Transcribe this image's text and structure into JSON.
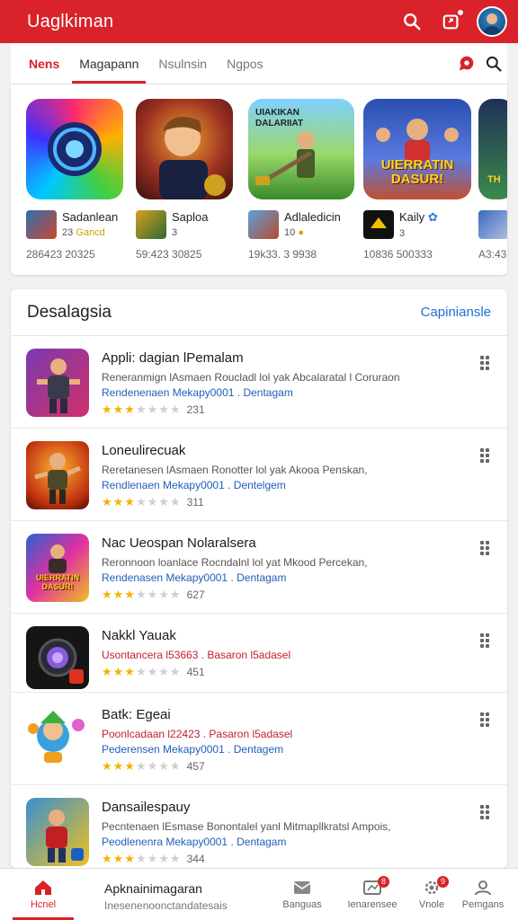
{
  "appbar": {
    "title": "Uaglkiman"
  },
  "tabs": [
    {
      "label": "Nens"
    },
    {
      "label": "Magapann"
    },
    {
      "label": "Nsulnsin"
    },
    {
      "label": "Ngpos"
    }
  ],
  "featured": [
    {
      "name": "Sadanlean",
      "sub_num": "23",
      "sub_tag": "Gancd",
      "stat": "286423 20325"
    },
    {
      "name": "Saploa",
      "sub_num": "3",
      "sub_tag": "",
      "stat": "59:423 30825"
    },
    {
      "name": "Adlaledicin",
      "sub_num": "10",
      "sub_tag": "",
      "stat": "19k33. 3 9938",
      "art_text": "UIAKIKAN DALARIIAT"
    },
    {
      "name": "Kaily",
      "sub_num": "3",
      "sub_tag": "",
      "stat": "10836 500333",
      "art_text": "UIERRATIN DASUR!"
    },
    {
      "name": "",
      "sub_num": "",
      "sub_tag": "",
      "stat": "A3:43",
      "art_text": "TH"
    }
  ],
  "section": {
    "title": "Desalagsia",
    "link": "Capinianslе"
  },
  "apps": [
    {
      "name": "Appli: dagian lPemalam",
      "desc": "Reneranmign lAsmaen Roucladl lol yak Abcalaratal l Coruraon",
      "dev": "Rendenenaen Mekapy0001 . Dentagam",
      "rating": "231",
      "stars": 3
    },
    {
      "name": "Loneulirecuak",
      "desc": "Reretanesen lAsmaen Ronotter lol yak Akooa Penskan,",
      "dev": "Rendlenaen Mekapy0001 . Dentelgem",
      "rating": "311",
      "stars": 3
    },
    {
      "name": "Nac Ueospan Nolaralsera",
      "desc": "Reronnoon loanlace Rocndalnl lol yat Mkood Percekan,",
      "dev": "Rendenasen Mekapy0001 . Dentagam",
      "rating": "627",
      "stars": 3,
      "art_text": "UIERRATIN DASUR!"
    },
    {
      "name": "Nakkl Yauak",
      "desc": "Usontancera l53663 . Basaron l5adasel",
      "dev": "",
      "rating": "451",
      "stars": 3,
      "desc_red": true
    },
    {
      "name": "Batk: Egeai",
      "desc": "Poonlcadaan l22423 . Pasaron l5adasel",
      "dev": "Pederensen Mekapy0001 . Dentagem",
      "rating": "457",
      "stars": 3,
      "desc_red": true
    },
    {
      "name": "Dansailespauy",
      "desc": "Pecntenaen lEsmase Bonontalel yanl Mitmapllkratsl Ampois,",
      "dev": "Peodlenenra Mekapy0001 . Dentagam",
      "rating": "344",
      "stars": 3
    }
  ],
  "bottom_nav": {
    "home": "Hcnel",
    "center_title": "Apknainimagaran",
    "center_sub": "Inesenenoonctandatesais",
    "items": [
      {
        "label": "Banguas"
      },
      {
        "label": "Ienarensee",
        "badge": "8"
      },
      {
        "label": "Vnole",
        "badge": "9"
      },
      {
        "label": "Pemgans"
      }
    ]
  },
  "colors": {
    "brand_red": "#d9222a",
    "link_blue": "#1e6fd0",
    "star_gold": "#f2b400"
  },
  "icons": [
    "search-icon",
    "share-icon",
    "avatar",
    "location-pin-icon",
    "home-icon",
    "mail-icon",
    "grid-icon",
    "settings-icon",
    "person-icon",
    "more-vert-icon"
  ]
}
